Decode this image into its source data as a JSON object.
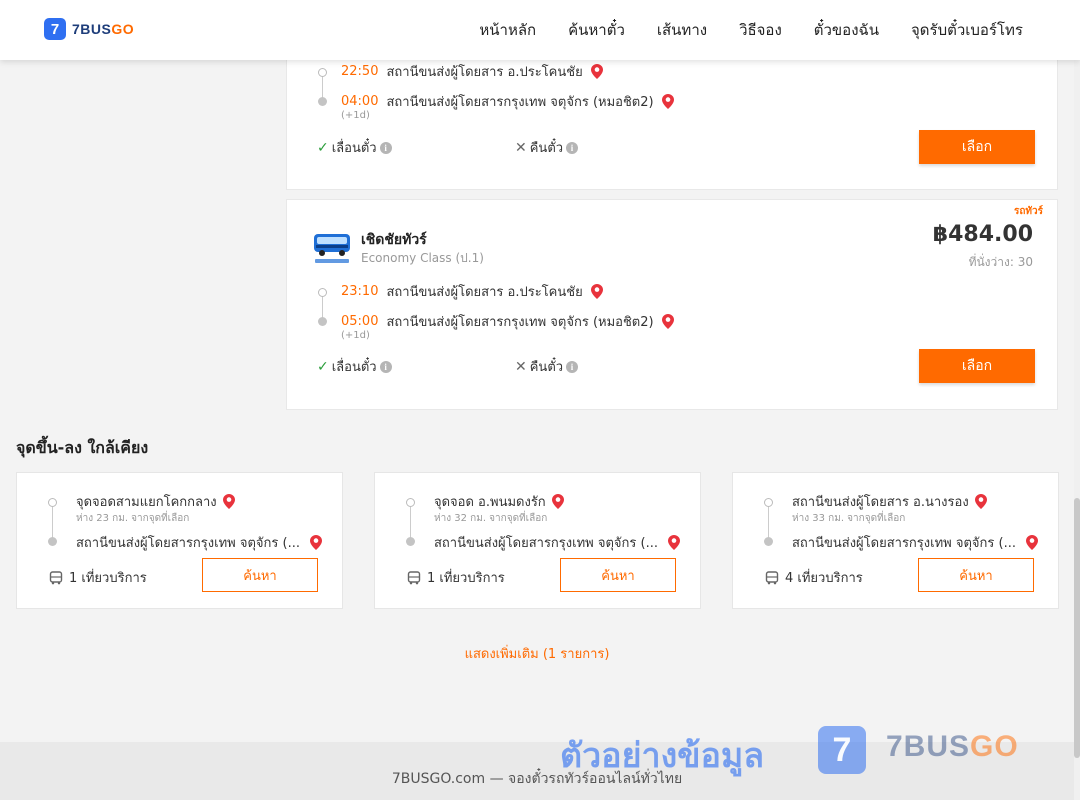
{
  "header": {
    "logo_icon": "7",
    "logo_brand": "7BUS",
    "logo_brand_accent": "GO",
    "nav": [
      "หน้าหลัก",
      "ค้นหาตั๋ว",
      "เส้นทาง",
      "วิธีจอง",
      "ตั๋วของฉัน",
      "จุดรับตั๋วเบอร์โทร"
    ]
  },
  "trips": [
    {
      "departure_time": "22:50",
      "departure_place": "สถานีขนส่งผู้โดยสาร อ.ประโคนชัย",
      "arrival_time": "04:00",
      "arrival_place": "สถานีขนส่งผู้โดยสารกรุงเทพ จตุจักร (หมอชิต2)",
      "arrival_day_offset": "(+1d)",
      "reschedule_label": "เลื่อนตั๋ว",
      "refund_label": "คืนตั๋ว",
      "select_label": "เลือก"
    },
    {
      "tag": "รถทัวร์",
      "operator_name": "เชิดชัยทัวร์",
      "operator_class": "Economy Class (ป.1)",
      "price": "฿484.00",
      "seats": "ที่นั่งว่าง: 30",
      "departure_time": "23:10",
      "departure_place": "สถานีขนส่งผู้โดยสาร อ.ประโคนชัย",
      "arrival_time": "05:00",
      "arrival_place": "สถานีขนส่งผู้โดยสารกรุงเทพ จตุจักร (หมอชิต2)",
      "arrival_day_offset": "(+1d)",
      "reschedule_label": "เลื่อนตั๋ว",
      "refund_label": "คืนตั๋ว",
      "select_label": "เลือก"
    }
  ],
  "nearby": {
    "title": "จุดขึ้น-ลง ใกล้เคียง",
    "items": [
      {
        "from": "จุดจอดสามแยกโคกกลาง",
        "distance": "ห่าง 23 กม. จากจุดที่เลือก",
        "to": "สถานีขนส่งผู้โดยสารกรุงเทพ จตุจักร (...",
        "trips": "1 เที่ยวบริการ",
        "search_label": "ค้นหา"
      },
      {
        "from": "จุดจอด อ.พนมดงรัก",
        "distance": "ห่าง 32 กม. จากจุดที่เลือก",
        "to": "สถานีขนส่งผู้โดยสารกรุงเทพ จตุจักร (...",
        "trips": "1 เที่ยวบริการ",
        "search_label": "ค้นหา"
      },
      {
        "from": "สถานีขนส่งผู้โดยสาร อ.นางรอง",
        "distance": "ห่าง 33 กม. จากจุดที่เลือก",
        "to": "สถานีขนส่งผู้โดยสารกรุงเทพ จตุจักร (...",
        "trips": "4 เที่ยวบริการ",
        "search_label": "ค้นหา"
      }
    ],
    "show_more": "แสดงเพิ่มเติม (1 รายการ)"
  },
  "footer": {
    "text": "7BUSGO.com — จองตั๋วรถทัวร์ออนไลน์ทั่วไทย"
  },
  "watermark": {
    "text": "ตัวอย่างข้อมูล",
    "icon": "7",
    "brand": "7BUS",
    "brand_accent": "GO"
  },
  "colors": {
    "accent": "#ff6a00",
    "brand_blue": "#2f6ff1",
    "check_green": "#2a9d3a",
    "pin_red": "#e8333c"
  },
  "icons": [
    "location-pin-icon",
    "check-icon",
    "cross-icon",
    "info-icon",
    "bus-icon",
    "operator-logo"
  ]
}
